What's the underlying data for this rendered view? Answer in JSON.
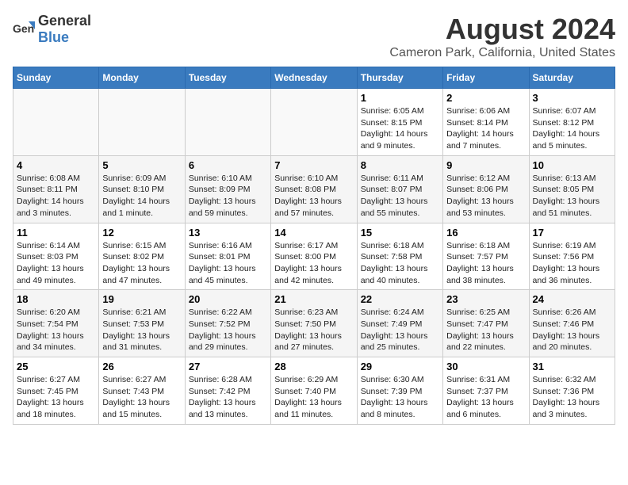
{
  "logo": {
    "text_general": "General",
    "text_blue": "Blue"
  },
  "header": {
    "title": "August 2024",
    "subtitle": "Cameron Park, California, United States"
  },
  "days_of_week": [
    "Sunday",
    "Monday",
    "Tuesday",
    "Wednesday",
    "Thursday",
    "Friday",
    "Saturday"
  ],
  "weeks": [
    [
      {
        "day": "",
        "info": ""
      },
      {
        "day": "",
        "info": ""
      },
      {
        "day": "",
        "info": ""
      },
      {
        "day": "",
        "info": ""
      },
      {
        "day": "1",
        "info": "Sunrise: 6:05 AM\nSunset: 8:15 PM\nDaylight: 14 hours\nand 9 minutes."
      },
      {
        "day": "2",
        "info": "Sunrise: 6:06 AM\nSunset: 8:14 PM\nDaylight: 14 hours\nand 7 minutes."
      },
      {
        "day": "3",
        "info": "Sunrise: 6:07 AM\nSunset: 8:12 PM\nDaylight: 14 hours\nand 5 minutes."
      }
    ],
    [
      {
        "day": "4",
        "info": "Sunrise: 6:08 AM\nSunset: 8:11 PM\nDaylight: 14 hours\nand 3 minutes."
      },
      {
        "day": "5",
        "info": "Sunrise: 6:09 AM\nSunset: 8:10 PM\nDaylight: 14 hours\nand 1 minute."
      },
      {
        "day": "6",
        "info": "Sunrise: 6:10 AM\nSunset: 8:09 PM\nDaylight: 13 hours\nand 59 minutes."
      },
      {
        "day": "7",
        "info": "Sunrise: 6:10 AM\nSunset: 8:08 PM\nDaylight: 13 hours\nand 57 minutes."
      },
      {
        "day": "8",
        "info": "Sunrise: 6:11 AM\nSunset: 8:07 PM\nDaylight: 13 hours\nand 55 minutes."
      },
      {
        "day": "9",
        "info": "Sunrise: 6:12 AM\nSunset: 8:06 PM\nDaylight: 13 hours\nand 53 minutes."
      },
      {
        "day": "10",
        "info": "Sunrise: 6:13 AM\nSunset: 8:05 PM\nDaylight: 13 hours\nand 51 minutes."
      }
    ],
    [
      {
        "day": "11",
        "info": "Sunrise: 6:14 AM\nSunset: 8:03 PM\nDaylight: 13 hours\nand 49 minutes."
      },
      {
        "day": "12",
        "info": "Sunrise: 6:15 AM\nSunset: 8:02 PM\nDaylight: 13 hours\nand 47 minutes."
      },
      {
        "day": "13",
        "info": "Sunrise: 6:16 AM\nSunset: 8:01 PM\nDaylight: 13 hours\nand 45 minutes."
      },
      {
        "day": "14",
        "info": "Sunrise: 6:17 AM\nSunset: 8:00 PM\nDaylight: 13 hours\nand 42 minutes."
      },
      {
        "day": "15",
        "info": "Sunrise: 6:18 AM\nSunset: 7:58 PM\nDaylight: 13 hours\nand 40 minutes."
      },
      {
        "day": "16",
        "info": "Sunrise: 6:18 AM\nSunset: 7:57 PM\nDaylight: 13 hours\nand 38 minutes."
      },
      {
        "day": "17",
        "info": "Sunrise: 6:19 AM\nSunset: 7:56 PM\nDaylight: 13 hours\nand 36 minutes."
      }
    ],
    [
      {
        "day": "18",
        "info": "Sunrise: 6:20 AM\nSunset: 7:54 PM\nDaylight: 13 hours\nand 34 minutes."
      },
      {
        "day": "19",
        "info": "Sunrise: 6:21 AM\nSunset: 7:53 PM\nDaylight: 13 hours\nand 31 minutes."
      },
      {
        "day": "20",
        "info": "Sunrise: 6:22 AM\nSunset: 7:52 PM\nDaylight: 13 hours\nand 29 minutes."
      },
      {
        "day": "21",
        "info": "Sunrise: 6:23 AM\nSunset: 7:50 PM\nDaylight: 13 hours\nand 27 minutes."
      },
      {
        "day": "22",
        "info": "Sunrise: 6:24 AM\nSunset: 7:49 PM\nDaylight: 13 hours\nand 25 minutes."
      },
      {
        "day": "23",
        "info": "Sunrise: 6:25 AM\nSunset: 7:47 PM\nDaylight: 13 hours\nand 22 minutes."
      },
      {
        "day": "24",
        "info": "Sunrise: 6:26 AM\nSunset: 7:46 PM\nDaylight: 13 hours\nand 20 minutes."
      }
    ],
    [
      {
        "day": "25",
        "info": "Sunrise: 6:27 AM\nSunset: 7:45 PM\nDaylight: 13 hours\nand 18 minutes."
      },
      {
        "day": "26",
        "info": "Sunrise: 6:27 AM\nSunset: 7:43 PM\nDaylight: 13 hours\nand 15 minutes."
      },
      {
        "day": "27",
        "info": "Sunrise: 6:28 AM\nSunset: 7:42 PM\nDaylight: 13 hours\nand 13 minutes."
      },
      {
        "day": "28",
        "info": "Sunrise: 6:29 AM\nSunset: 7:40 PM\nDaylight: 13 hours\nand 11 minutes."
      },
      {
        "day": "29",
        "info": "Sunrise: 6:30 AM\nSunset: 7:39 PM\nDaylight: 13 hours\nand 8 minutes."
      },
      {
        "day": "30",
        "info": "Sunrise: 6:31 AM\nSunset: 7:37 PM\nDaylight: 13 hours\nand 6 minutes."
      },
      {
        "day": "31",
        "info": "Sunrise: 6:32 AM\nSunset: 7:36 PM\nDaylight: 13 hours\nand 3 minutes."
      }
    ]
  ]
}
